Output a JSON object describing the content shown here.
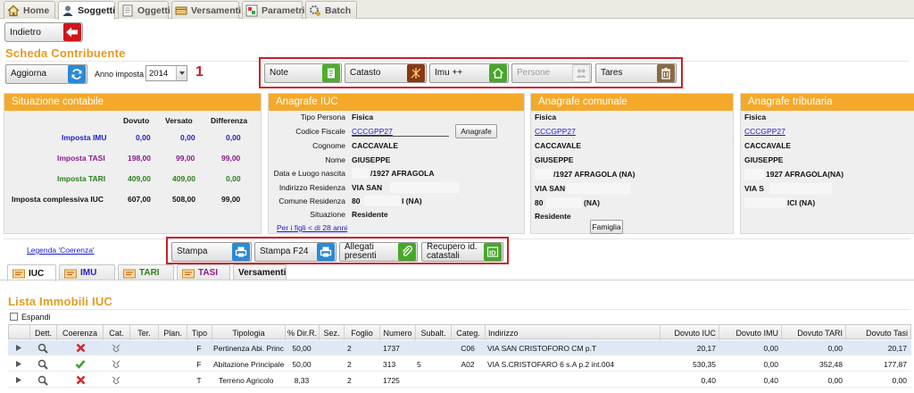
{
  "tabs": [
    {
      "label": "Home",
      "icon": "home-icon"
    },
    {
      "label": "Soggetti",
      "icon": "person-icon"
    },
    {
      "label": "Oggetti",
      "icon": "document-icon"
    },
    {
      "label": "Versamenti",
      "icon": "payment-icon"
    },
    {
      "label": "Parametri",
      "icon": "settings-panel-icon"
    },
    {
      "label": "Batch",
      "icon": "batch-gear-icon"
    }
  ],
  "back_button": "Indietro",
  "page_title": "Scheda Contribuente",
  "refresh_button": "Aggiorna",
  "year": {
    "label": "Anno imposta",
    "value": "2014"
  },
  "annotation_1": "1",
  "toolbar1": [
    {
      "label": "Note",
      "icon": "note-icon",
      "disabled": false
    },
    {
      "label": "Catasto",
      "icon": "cadastre-icon",
      "disabled": false
    },
    {
      "label": "Imu ++",
      "icon": "house-icon",
      "disabled": false
    },
    {
      "label": "Persone",
      "icon": "persons-icon",
      "disabled": true
    },
    {
      "label": "Tares",
      "icon": "trash-bin-icon",
      "disabled": false
    }
  ],
  "situazione": {
    "title": "Situazione contabile",
    "headers": [
      "Dovuto",
      "Versato",
      "Differenza"
    ],
    "rows": [
      {
        "label": "Imposta IMU",
        "color": "#1e1ec8",
        "dovuto": "0,00",
        "versato": "0,00",
        "differenza": "0,00"
      },
      {
        "label": "Imposta TASI",
        "color": "#8b1a8b",
        "dovuto": "198,00",
        "versato": "99,00",
        "differenza": "99,00"
      },
      {
        "label": "Imposta TARI",
        "color": "#2e7d1e",
        "dovuto": "409,00",
        "versato": "409,00",
        "differenza": "0,00"
      },
      {
        "label": "Imposta complessiva IUC",
        "color": "#111111",
        "dovuto": "607,00",
        "versato": "508,00",
        "differenza": "99,00"
      }
    ]
  },
  "anagrafe_iuc": {
    "title": "Anagrafe IUC",
    "tipo_persona_label": "Tipo Persona",
    "tipo_persona": "Fisica",
    "cf_label": "Codice Fiscale",
    "cf": "CCCGPP27",
    "anagrafe_button": "Anagrafe",
    "cognome_label": "Cognome",
    "cognome": "CACCAVALE",
    "nome_label": "Nome",
    "nome": "GIUSEPPE",
    "nascita_label": "Data e Luogo nascita",
    "nascita": "/1927 AFRAGOLA",
    "indirizzo_label": "Indirizzo Residenza",
    "indirizzo": "VIA SAN",
    "comune_label": "Comune Residenza",
    "comune_a": "80",
    "comune_b": "I (NA)",
    "situazione_label": "Situazione",
    "situazione": "Residente",
    "figli_link": "Per i figli < di 28 anni"
  },
  "anagrafe_comunale": {
    "title": "Anagrafe comunale",
    "tipo": "Fisica",
    "cf": "CCCGPP27",
    "cognome": "CACCAVALE",
    "nome": "GIUSEPPE",
    "nascita": "/1927 AFRAGOLA (NA)",
    "indirizzo": "VIA SAN",
    "comune_a": "80",
    "comune_b": "(NA)",
    "situazione": "Residente",
    "famiglia_button": "Famiglia"
  },
  "anagrafe_tributaria": {
    "title": "Anagrafe tributaria",
    "tipo": "Fisica",
    "cf": "CCCGPP27",
    "cognome": "CACCAVALE",
    "nome": "GIUSEPPE",
    "nascita": "1927 AFRAGOLA(NA)",
    "indirizzo": "VIA S",
    "comune": "ICI (NA)"
  },
  "legend_link": "Legenda 'Coerenza'",
  "toolbar2": [
    {
      "label": "Stampa",
      "icon": "printer-icon"
    },
    {
      "label": "Stampa F24",
      "icon": "printer-f24-icon"
    },
    {
      "label": "Allegati presenti",
      "icon": "attachment-icon"
    },
    {
      "label": "Recupero id. catastali",
      "icon": "id-icon"
    }
  ],
  "subtabs": [
    {
      "label": "IUC",
      "mini": "IUC",
      "color": "#111"
    },
    {
      "label": "IMU",
      "mini": "IMU",
      "color": "#1e1ec8"
    },
    {
      "label": "TARI",
      "mini": "TARI",
      "color": "#2e7d1e"
    },
    {
      "label": "TASI",
      "mini": "TASI",
      "color": "#8b1a8b"
    },
    {
      "label": "Versamenti",
      "mini": "",
      "color": "#111"
    }
  ],
  "list_title": "Lista Immobili IUC",
  "espandi": "Espandi",
  "table": {
    "headers": [
      "Dett.",
      "Coerenza",
      "Cat.",
      "Ter.",
      "Plan.",
      "Tipo",
      "Tipologia",
      "% Dir.R.",
      "Sez.",
      "Foglio",
      "Numero",
      "Subalt.",
      "Categ.",
      "Indirizzo",
      "Dovuto IUC",
      "Dovuto IMU",
      "Dovuto TARI",
      "Dovuto Tasi"
    ],
    "rows": [
      {
        "coerenza": "error",
        "tipo": "F",
        "tipologia": "Pertinenza Abi. Princ",
        "dir": "50,00",
        "sez": "",
        "foglio": "2",
        "numero": "1737",
        "subalt": "",
        "categ": "C06",
        "indirizzo": "VIA SAN CRISTOFORO CM p.T",
        "iuc": "20,17",
        "imu": "0,00",
        "tari": "0,00",
        "tasi": "20,17"
      },
      {
        "coerenza": "ok",
        "tipo": "F",
        "tipologia": "Abitazione Principale",
        "dir": "50,00",
        "sez": "",
        "foglio": "2",
        "numero": "313",
        "subalt": "5",
        "categ": "A02",
        "indirizzo": "VIA S.CRISTOFARO 6 s.A p.2 int.004",
        "iuc": "530,35",
        "imu": "0,00",
        "tari": "352,48",
        "tasi": "177,87"
      },
      {
        "coerenza": "error",
        "tipo": "T",
        "tipologia": "Terreno Agricolo",
        "dir": "8,33",
        "sez": "",
        "foglio": "2",
        "numero": "1725",
        "subalt": "",
        "categ": "",
        "indirizzo": "",
        "iuc": "0,40",
        "imu": "0,40",
        "tari": "0,00",
        "tasi": "0,00"
      }
    ]
  }
}
